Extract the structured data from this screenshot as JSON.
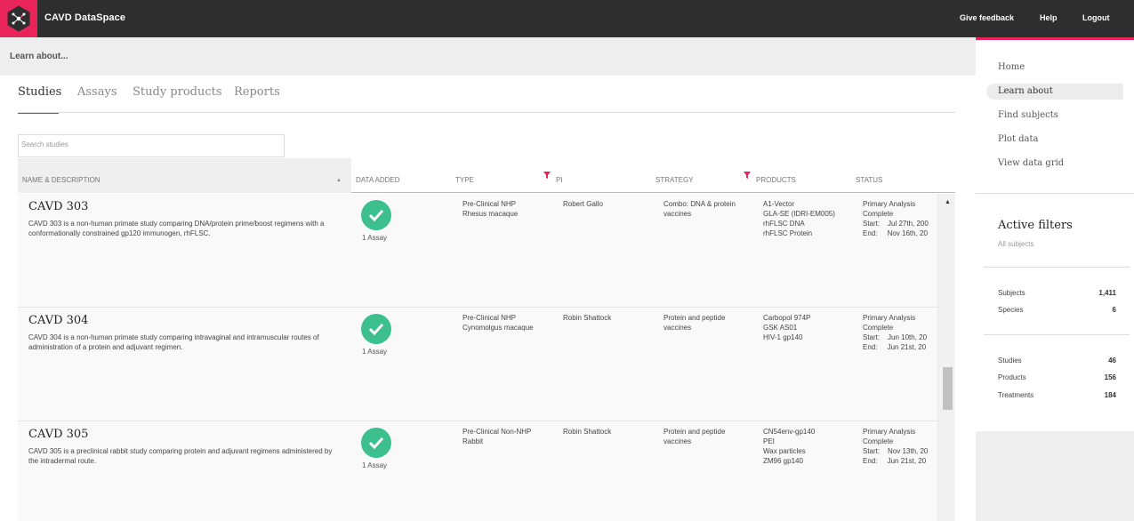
{
  "app": {
    "title": "CAVD DataSpace",
    "links": [
      "Give feedback",
      "Help",
      "Logout"
    ],
    "accent_color": "#e9245b"
  },
  "subheader": {
    "title": "Learn about..."
  },
  "tabs": [
    "Studies",
    "Assays",
    "Study products",
    "Reports"
  ],
  "active_tab": "Studies",
  "search": {
    "placeholder": "Search studies"
  },
  "table": {
    "columns": [
      "NAME & DESCRIPTION",
      "DATA ADDED",
      "TYPE",
      "PI",
      "STRATEGY",
      "PRODUCTS",
      "STATUS"
    ],
    "sort_indicator": "▲",
    "rows": [
      {
        "name": "CAVD 303",
        "desc": "CAVD 303 is a non-human primate study comparing DNA/protein prime/boost regimens with a conformationally constrained gp120 immunogen, rhFLSC.",
        "assays": "1 Assay",
        "type": [
          "Pre-Clinical NHP",
          "Rhesus macaque"
        ],
        "pi": "Robert Gallo",
        "strategy": [
          "Combo: DNA & protein",
          "vaccines"
        ],
        "products": [
          "A1-Vector",
          "GLA-SE (IDRI-EM005)",
          "rhFLSC DNA",
          "rhFLSC Protein"
        ],
        "status": [
          "Primary Analysis",
          "Complete",
          "Start:    Jul 27th, 200",
          "End:     Nov 16th, 20"
        ]
      },
      {
        "name": "CAVD 304",
        "desc": "CAVD 304 is a non-human primate study comparing intravaginal and intramuscular routes of administration of a protein and adjuvant regimen.",
        "assays": "1 Assay",
        "type": [
          "Pre-Clinical NHP",
          "Cynomolgus macaque"
        ],
        "pi": "Robin Shattock",
        "strategy": [
          "Protein and peptide",
          "vaccines"
        ],
        "products": [
          "Carbopol 974P",
          "GSK AS01",
          "HIV-1 gp140"
        ],
        "status": [
          "Primary Analysis",
          "Complete",
          "Start:    Jun 10th, 20",
          "End:     Jun 21st, 20"
        ]
      },
      {
        "name": "CAVD 305",
        "desc": "CAVD 305 is a preclinical rabbit study comparing protein and adjuvant regimens administered by the intradermal route.",
        "assays": "1 Assay",
        "type": [
          "Pre-Clinical Non-NHP",
          "Rabbit"
        ],
        "pi": "Robin Shattock",
        "strategy": [
          "Protein and peptide",
          "vaccines"
        ],
        "products": [
          "CN54env-gp140",
          "PEI",
          "Wax particles",
          "ZM96 gp140"
        ],
        "status": [
          "Primary Analysis",
          "Complete",
          "Start:    Nov 13th, 20",
          "End:     Jun 21st, 20"
        ]
      }
    ]
  },
  "nav": {
    "items": [
      "Home",
      "Learn about",
      "Find subjects",
      "Plot data",
      "View data grid"
    ],
    "active": "Learn about"
  },
  "filters": {
    "title": "Active filters",
    "subtitle": "All subjects",
    "group1": [
      {
        "label": "Subjects",
        "value": "1,411"
      },
      {
        "label": "Species",
        "value": "6"
      }
    ],
    "group2": [
      {
        "label": "Studies",
        "value": "46"
      },
      {
        "label": "Products",
        "value": "156"
      },
      {
        "label": "Treatments",
        "value": "184"
      }
    ]
  },
  "icons": {
    "logo": "dataspace-logo-icon",
    "check": "check-circle-icon",
    "filter": "funnel-filter-icon",
    "scroll_up": "scroll-up-arrow-icon"
  },
  "scroll_up_glyph": "▲"
}
